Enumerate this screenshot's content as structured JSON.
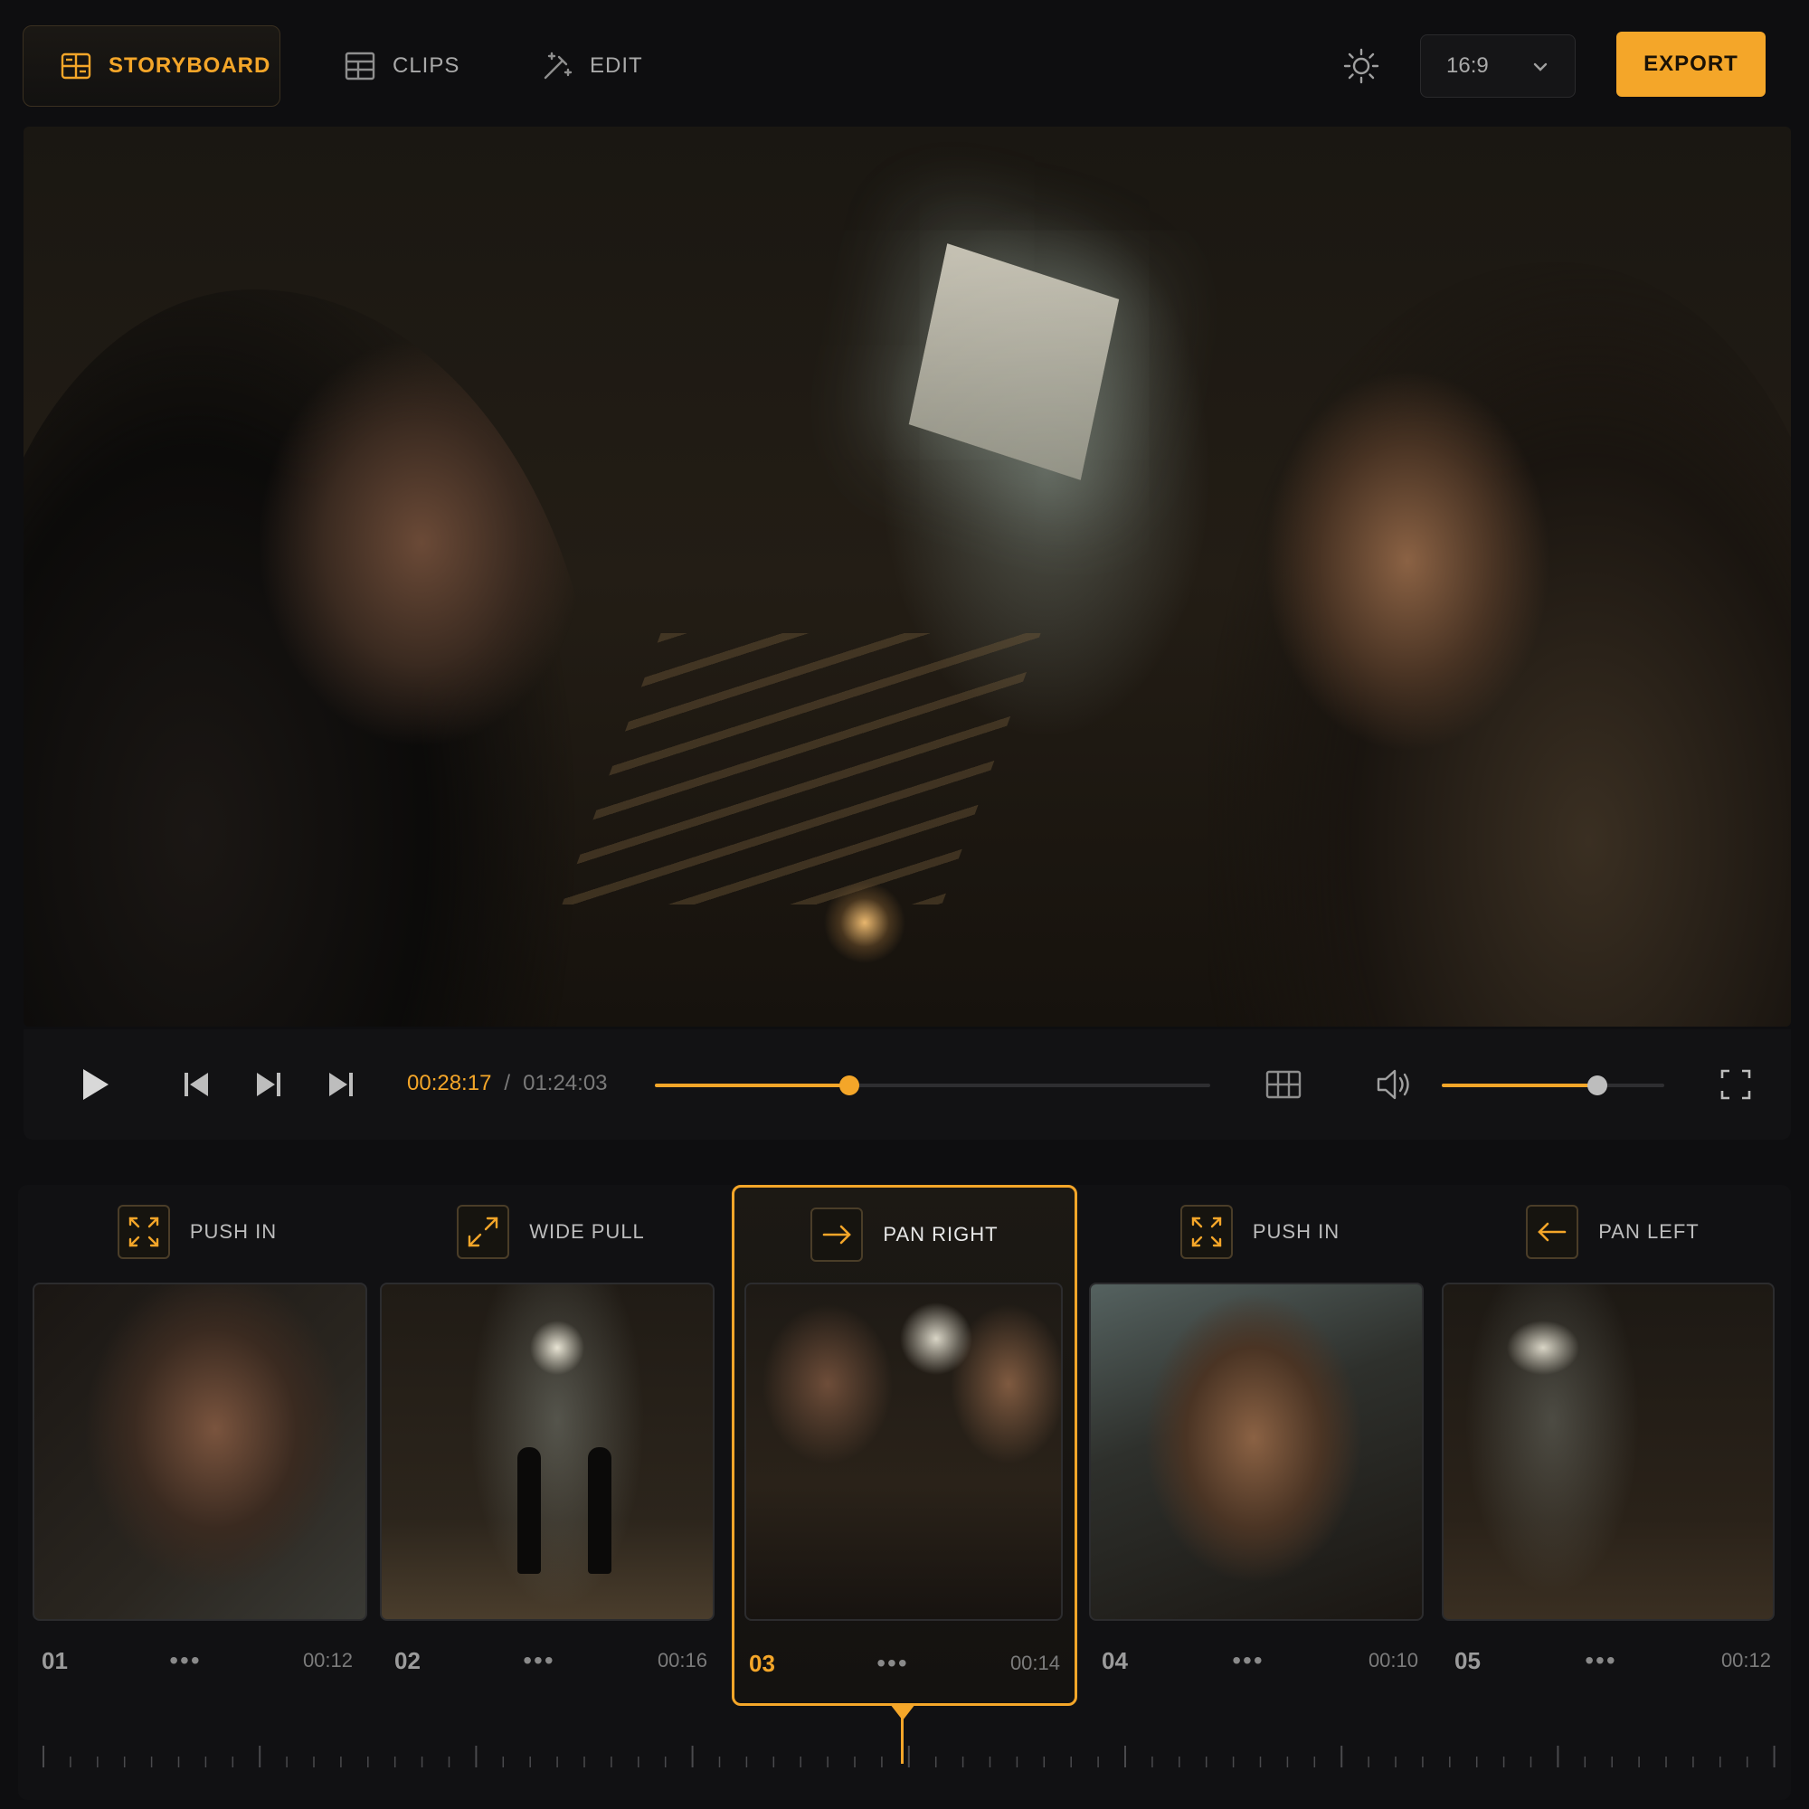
{
  "topbar": {
    "tabs": [
      {
        "label": "STORYBOARD",
        "icon": "storyboard-icon",
        "active": true
      },
      {
        "label": "CLIPS",
        "icon": "clips-grid-icon",
        "active": false
      },
      {
        "label": "EDIT",
        "icon": "magic-wand-icon",
        "active": false
      }
    ],
    "aspect_ratio": "16:9",
    "export_label": "EXPORT"
  },
  "player": {
    "current_time": "00:28:17",
    "separator": "/",
    "total_time": "01:24:03",
    "progress_fraction": 0.35,
    "volume_fraction": 0.7
  },
  "storyboard": {
    "shots": [
      {
        "number": "01",
        "move": "PUSH IN",
        "move_icon": "push-in-icon",
        "duration": "00:12",
        "selected": false
      },
      {
        "number": "02",
        "move": "WIDE PULL",
        "move_icon": "wide-pull-icon",
        "duration": "00:16",
        "selected": false
      },
      {
        "number": "03",
        "move": "PAN RIGHT",
        "move_icon": "arrow-right-icon",
        "duration": "00:14",
        "selected": true
      },
      {
        "number": "04",
        "move": "PUSH IN",
        "move_icon": "push-in-icon",
        "duration": "00:10",
        "selected": false
      },
      {
        "number": "05",
        "move": "PAN LEFT",
        "move_icon": "arrow-left-icon",
        "duration": "00:12",
        "selected": false
      }
    ],
    "more_glyph": "•••"
  },
  "colors": {
    "accent": "#f4a629",
    "background": "#0e0e10",
    "panel": "#121214"
  }
}
